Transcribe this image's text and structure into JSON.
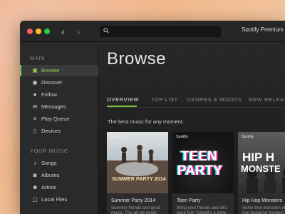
{
  "app": {
    "premium_label": "Spotify Premium"
  },
  "sidebar": {
    "sections": [
      {
        "label": "MAIN",
        "items": [
          {
            "label": "Browse",
            "icon": "browse-icon",
            "active": true
          },
          {
            "label": "Discover",
            "icon": "discover-icon"
          },
          {
            "label": "Follow",
            "icon": "follow-icon"
          },
          {
            "label": "Messages",
            "icon": "messages-icon"
          },
          {
            "label": "Play Queue",
            "icon": "queue-icon"
          },
          {
            "label": "Devices",
            "icon": "devices-icon"
          }
        ]
      },
      {
        "label": "YOUR MUSIC",
        "items": [
          {
            "label": "Songs",
            "icon": "music-note-icon"
          },
          {
            "label": "Albums",
            "icon": "album-icon"
          },
          {
            "label": "Artists",
            "icon": "artists-icon"
          },
          {
            "label": "Local Files",
            "icon": "local-files-icon"
          }
        ]
      }
    ]
  },
  "main": {
    "title": "Browse",
    "tabs": [
      "OVERVIEW",
      "TOP LIST",
      "GENRES & MOODS",
      "NEW RELEASES"
    ],
    "active_tab": "OVERVIEW",
    "tagline": "The best music for any moment.",
    "cards": [
      {
        "tag": "Spotify",
        "art_text": "SUMMER PARTY 2014",
        "title": "Summer Party 2014",
        "desc": "Summer friends and good music. This all we need!"
      },
      {
        "tag": "Spotify",
        "art_text_1": "TEEN",
        "art_text_2": "PARTY",
        "title": "Teen Party",
        "desc": "Bring your friends and let's have fun! Tonight's a party on us, so..."
      },
      {
        "tag": "Spotify",
        "art_text_1": "HIP H",
        "art_text_2": "MONSTE",
        "title": "Hip Hop Monsters",
        "desc": "Some true monsters of hip hop featuring freshest hits, old..."
      }
    ]
  },
  "colors": {
    "accent": "#80c43c",
    "window_bg": "#1c1c1c",
    "sidebar_bg": "#2a2a2a"
  }
}
